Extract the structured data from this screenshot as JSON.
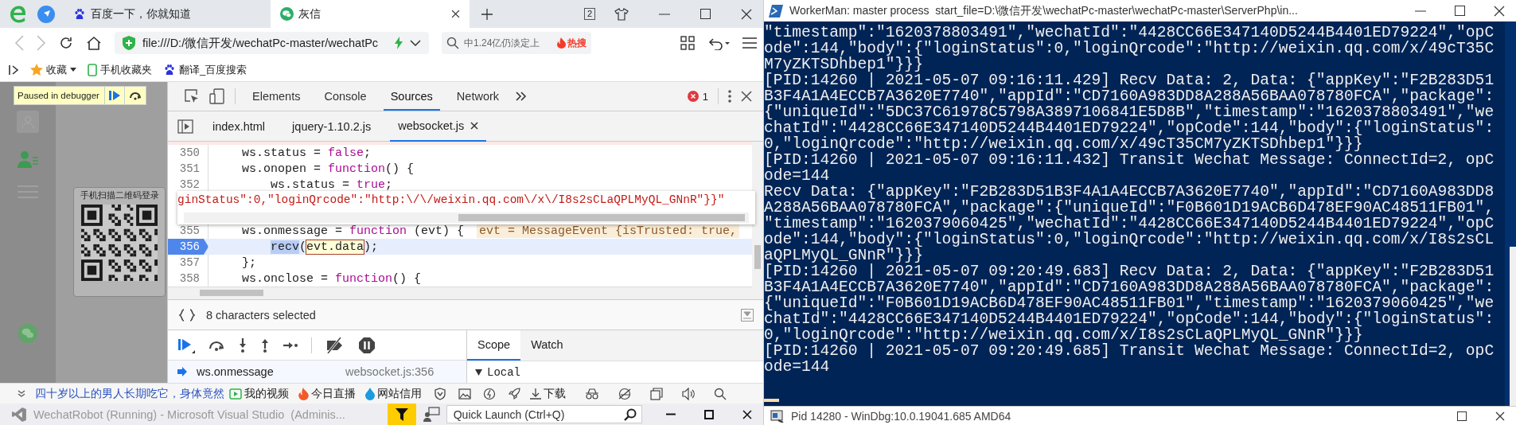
{
  "browser": {
    "tabs": [
      {
        "title": "百度一下，你就知道",
        "kind": "paw",
        "selected": false
      },
      {
        "title": "灰信",
        "kind": "chat",
        "selected": true
      }
    ],
    "tab_count": "2",
    "address": "file:///D:/微信开发/wechatPc-master/wechatPc",
    "search": {
      "placeholder": "中1.24亿仍淡定上"
    },
    "hot_badge": "热搜",
    "bookmarks": [
      {
        "label": "收藏",
        "kind": "star"
      },
      {
        "label": "手机收藏夹",
        "kind": "phone"
      },
      {
        "label": "翻译_百度搜索",
        "kind": "paw"
      }
    ]
  },
  "page": {
    "debugger_badge": "Paused in debugger",
    "login_card_title": "手机扫描二维码登录"
  },
  "devtools": {
    "tabs": [
      {
        "label": "Elements",
        "selected": false
      },
      {
        "label": "Console",
        "selected": false
      },
      {
        "label": "Sources",
        "selected": true
      },
      {
        "label": "Network",
        "selected": false
      }
    ],
    "error_count": "1",
    "file_tabs": [
      {
        "label": "index.html",
        "selected": false
      },
      {
        "label": "jquery-1.10.2.js",
        "selected": false
      },
      {
        "label": "websocket.js",
        "selected": true
      }
    ],
    "code_lines": [
      {
        "kind": "statement",
        "number": "350",
        "current": false,
        "segments": [
          {
            "text": "ws.status = ",
            "kind": "plain"
          },
          {
            "text": "false",
            "kind": "keyword"
          },
          {
            "text": ";",
            "kind": "plain"
          }
        ]
      },
      {
        "kind": "statement",
        "number": "351",
        "current": false,
        "segments": [
          {
            "text": "ws.onopen = ",
            "kind": "plain"
          },
          {
            "text": "function",
            "kind": "keyword"
          },
          {
            "text": "() {",
            "kind": "plain"
          }
        ]
      },
      {
        "kind": "nested",
        "number": "352",
        "current": false,
        "segments": [
          {
            "text": "ws.status = ",
            "kind": "plain"
          },
          {
            "text": "true",
            "kind": "keyword"
          },
          {
            "text": ";",
            "kind": "plain"
          }
        ]
      },
      {
        "kind": "hidden"
      },
      {
        "kind": "statement",
        "number": "355",
        "current": false,
        "segments": [
          {
            "text": "ws.onmessage = ",
            "kind": "plain"
          },
          {
            "text": "function",
            "kind": "keyword"
          },
          {
            "text": " (evt) {",
            "kind": "plain"
          }
        ],
        "inline_value": "evt = MessageEvent {isTrusted: true,"
      },
      {
        "kind": "nested",
        "number": "356",
        "current": true,
        "segments": [
          {
            "text": "recv",
            "kind": "selected"
          },
          {
            "text": "(",
            "kind": "plain"
          },
          {
            "text": "evt.data",
            "kind": "inspected"
          },
          {
            "text": ");",
            "kind": "plain"
          }
        ]
      },
      {
        "kind": "statement",
        "number": "357",
        "current": false,
        "segments": [
          {
            "text": "};",
            "kind": "plain"
          }
        ]
      },
      {
        "kind": "statement",
        "number": "358",
        "current": false,
        "segments": [
          {
            "text": "ws.onclose = ",
            "kind": "plain"
          },
          {
            "text": "function",
            "kind": "keyword"
          },
          {
            "text": "() {",
            "kind": "plain"
          }
        ]
      }
    ],
    "tooltip": "ginStatus\":0,\"loginQrcode\":\"http:\\/\\/weixin.qq.com\\/x\\/I8s2sCLaQPLMyQL_GNnR\"}}\"",
    "selection_status": "8 characters selected",
    "call_stack": [
      {
        "function": "ws.onmessage",
        "location": "websocket.js:356",
        "selected": true
      }
    ],
    "side_tabs": [
      {
        "label": "Scope",
        "selected": true
      },
      {
        "label": "Watch",
        "selected": false
      }
    ],
    "scope": {
      "label": "Local",
      "expanded": true
    }
  },
  "status_bar": {
    "news": "四十岁以上的男人长期吃它，身体竟然",
    "items": [
      {
        "label": "我的视频",
        "kind": "video"
      },
      {
        "label": "今日直播",
        "kind": "live"
      },
      {
        "label": "网站信用",
        "kind": "credit"
      },
      {
        "label": "下载",
        "kind": "download"
      }
    ]
  },
  "visual_studio": {
    "title": "WechatRobot (Running) - Microsoft Visual Studio  (Adminis...",
    "quick_launch": {
      "placeholder": "Quick Launch (Ctrl+Q)"
    }
  },
  "terminal": {
    "title": "WorkerMan: master process  start_file=D:\\微信开发\\wechatPc-master\\wechatPc-master\\ServerPhp\\in...",
    "lines": [
      "\"timestamp\":\"1620378803491\",\"wechatId\":\"4428CC66E347140D5244B4401ED79224\",\"opC",
      "ode\":144,\"body\":{\"loginStatus\":0,\"loginQrcode\":\"http://weixin.qq.com/x/49cT35C",
      "M7yZKTSDhbep1\"}}}",
      "[PID:14260 | 2021-05-07 09:16:11.429] Recv Data: 2, Data: {\"appKey\":\"F2B283D51",
      "B3F4A1A4ECCB7A3620E7740\",\"appId\":\"CD7160A983DD8A288A56BAA078780FCA\",\"package\":",
      "{\"uniqueId\":\"5DC37C61978C5798A3897106841E5D8B\",\"timestamp\":\"1620378803491\",\"we",
      "chatId\":\"4428CC66E347140D5244B4401ED79224\",\"opCode\":144,\"body\":{\"loginStatus\":",
      "0,\"loginQrcode\":\"http://weixin.qq.com/x/49cT35CM7yZKTSDhbep1\"}}}",
      "[PID:14260 | 2021-05-07 09:16:11.432] Transit Wechat Message: ConnectId=2, opC",
      "ode=144",
      "Recv Data: {\"appKey\":\"F2B283D51B3F4A1A4ECCB7A3620E7740\",\"appId\":\"CD7160A983DD8",
      "A288A56BAA078780FCA\",\"package\":{\"uniqueId\":\"F0B601D19ACB6D478EF90AC48511FB01\",",
      "\"timestamp\":\"1620379060425\",\"wechatId\":\"4428CC66E347140D5244B4401ED79224\",\"opC",
      "ode\":144,\"body\":{\"loginStatus\":0,\"loginQrcode\":\"http://weixin.qq.com/x/I8s2sCL",
      "aQPLMyQL_GNnR\"}}}",
      "[PID:14260 | 2021-05-07 09:20:49.683] Recv Data: 2, Data: {\"appKey\":\"F2B283D51",
      "B3F4A1A4ECCB7A3620E7740\",\"appId\":\"CD7160A983DD8A288A56BAA078780FCA\",\"package\":",
      "{\"uniqueId\":\"F0B601D19ACB6D478EF90AC48511FB01\",\"timestamp\":\"1620379060425\",\"we",
      "chatId\":\"4428CC66E347140D5244B4401ED79224\",\"opCode\":144,\"body\":{\"loginStatus\":",
      "0,\"loginQrcode\":\"http://weixin.qq.com/x/I8s2sCLaQPLMyQL_GNnR\"}}}",
      "[PID:14260 | 2021-05-07 09:20:49.685] Transit Wechat Message: ConnectId=2, opC",
      "ode=144"
    ]
  },
  "windbg": {
    "title": "Pid 14280 - WinDbg:10.0.19041.685 AMD64"
  }
}
